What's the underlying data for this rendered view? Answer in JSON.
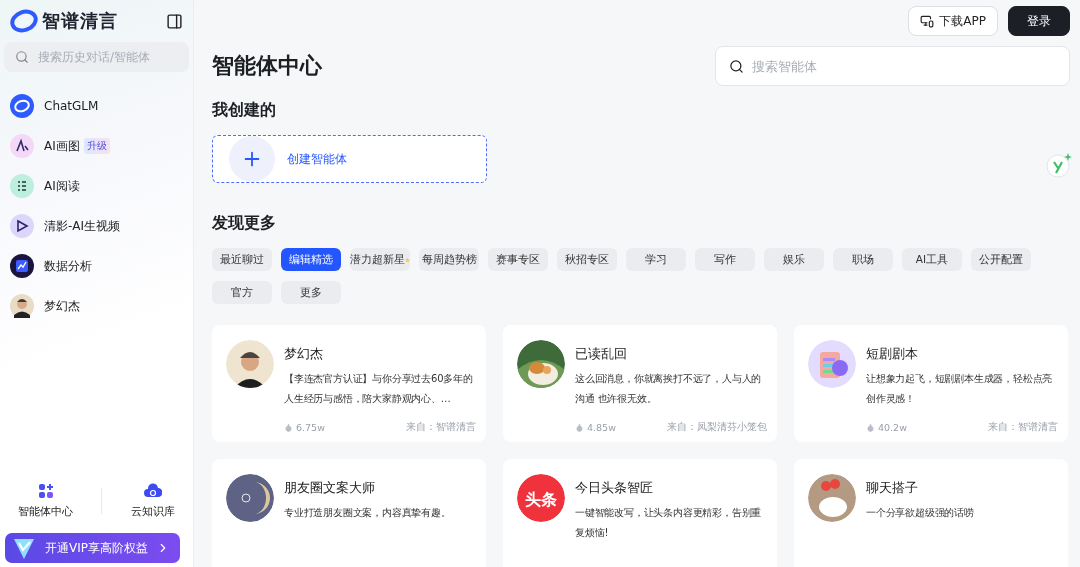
{
  "sidebar": {
    "brand": "智谱清言",
    "search": {
      "placeholder": "搜索历史对话/智能体"
    },
    "items": [
      {
        "label": "ChatGLM",
        "kind": "ring"
      },
      {
        "label": "AI画图",
        "kind": "draw",
        "badge": "升级"
      },
      {
        "label": "AI阅读",
        "kind": "read"
      },
      {
        "label": "清影-AI生视频",
        "kind": "video"
      },
      {
        "label": "数据分析",
        "kind": "chart"
      },
      {
        "label": "梦幻杰",
        "kind": "person"
      }
    ],
    "bottom_nav": [
      {
        "label": "智能体中心",
        "kind": "grid"
      },
      {
        "label": "云知识库",
        "kind": "cloud"
      }
    ],
    "vip_banner": "开通VIP享高阶权益"
  },
  "header": {
    "download_button": "下载APP",
    "login_button": "登录"
  },
  "page_title": "智能体中心",
  "search": {
    "placeholder": "搜索智能体"
  },
  "mine": {
    "heading": "我创建的",
    "create_label": "创建智能体"
  },
  "discover": {
    "heading": "发现更多",
    "chips": [
      {
        "label": "最近聊过",
        "selected": false
      },
      {
        "label": "编辑精选",
        "selected": true
      },
      {
        "label": "潜力超新星",
        "selected": false,
        "star": true
      },
      {
        "label": "每周趋势榜",
        "selected": false
      },
      {
        "label": "赛事专区",
        "selected": false
      },
      {
        "label": "秋招专区",
        "selected": false
      },
      {
        "label": "学习",
        "selected": false
      },
      {
        "label": "写作",
        "selected": false
      },
      {
        "label": "娱乐",
        "selected": false
      },
      {
        "label": "职场",
        "selected": false
      },
      {
        "label": "AI工具",
        "selected": false
      },
      {
        "label": "公开配置",
        "selected": false
      },
      {
        "label": "官方",
        "selected": false
      },
      {
        "label": "更多",
        "selected": false
      }
    ],
    "cards": [
      {
        "name": "梦幻杰",
        "kind": "person",
        "description": "【李连杰官方认证】与你分享过去60多年的人生经历与感悟，陪大家静观内心、…",
        "count": "6.75w",
        "source": "来自：智谱清言"
      },
      {
        "name": "已读乱回",
        "kind": "cat",
        "description": "这么回消息，你就离挨打不远了，人与人的沟通 也许很无效。",
        "count": "4.85w",
        "source": "来自：凤梨清芬小笼包"
      },
      {
        "name": "短剧剧本",
        "kind": "clipboard",
        "description": "让想象力起飞，短剧剧本生成器，轻松点亮创作灵感！",
        "count": "40.2w",
        "source": "来自：智谱清言"
      },
      {
        "name": "朋友圈文案大师",
        "kind": "moon",
        "description": "专业打造朋友圈文案，内容真挚有趣。"
      },
      {
        "name": "今日头条智匠",
        "kind": "logo",
        "avatar_text": "头条",
        "description": "一键智能改写，让头条内容更精彩，告别重复烦恼!"
      },
      {
        "name": "聊天搭子",
        "kind": "bear",
        "description": "一个分享欲超级强的话唠"
      }
    ]
  }
}
